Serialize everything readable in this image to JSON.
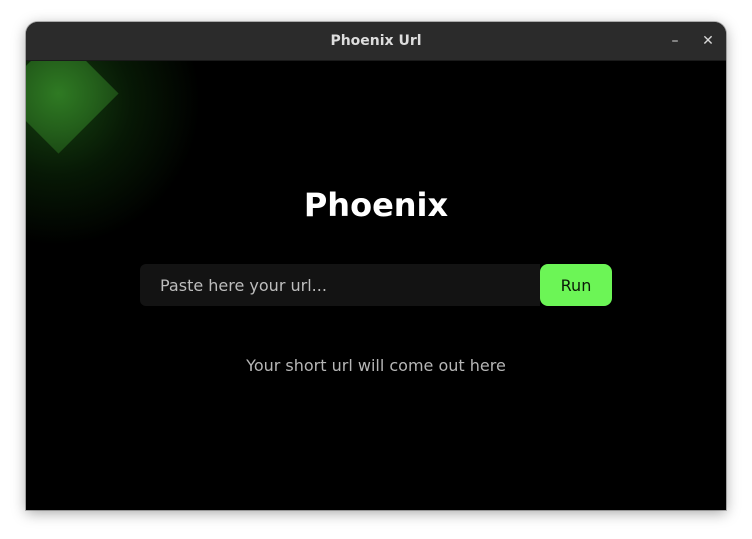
{
  "window": {
    "title": "Phoenix Url",
    "minimize_symbol": "–",
    "close_symbol": "✕"
  },
  "main": {
    "heading": "Phoenix",
    "url_input": {
      "placeholder": "Paste here your url...",
      "value": ""
    },
    "run_label": "Run",
    "output_text": "Your short url will come out here"
  },
  "colors": {
    "accent": "#6cf556",
    "background": "#000000",
    "titlebar": "#2b2b2b",
    "input_background": "#131313",
    "decoration_green": "#2f7a23"
  },
  "icons": [
    "minimize-icon",
    "close-icon"
  ]
}
